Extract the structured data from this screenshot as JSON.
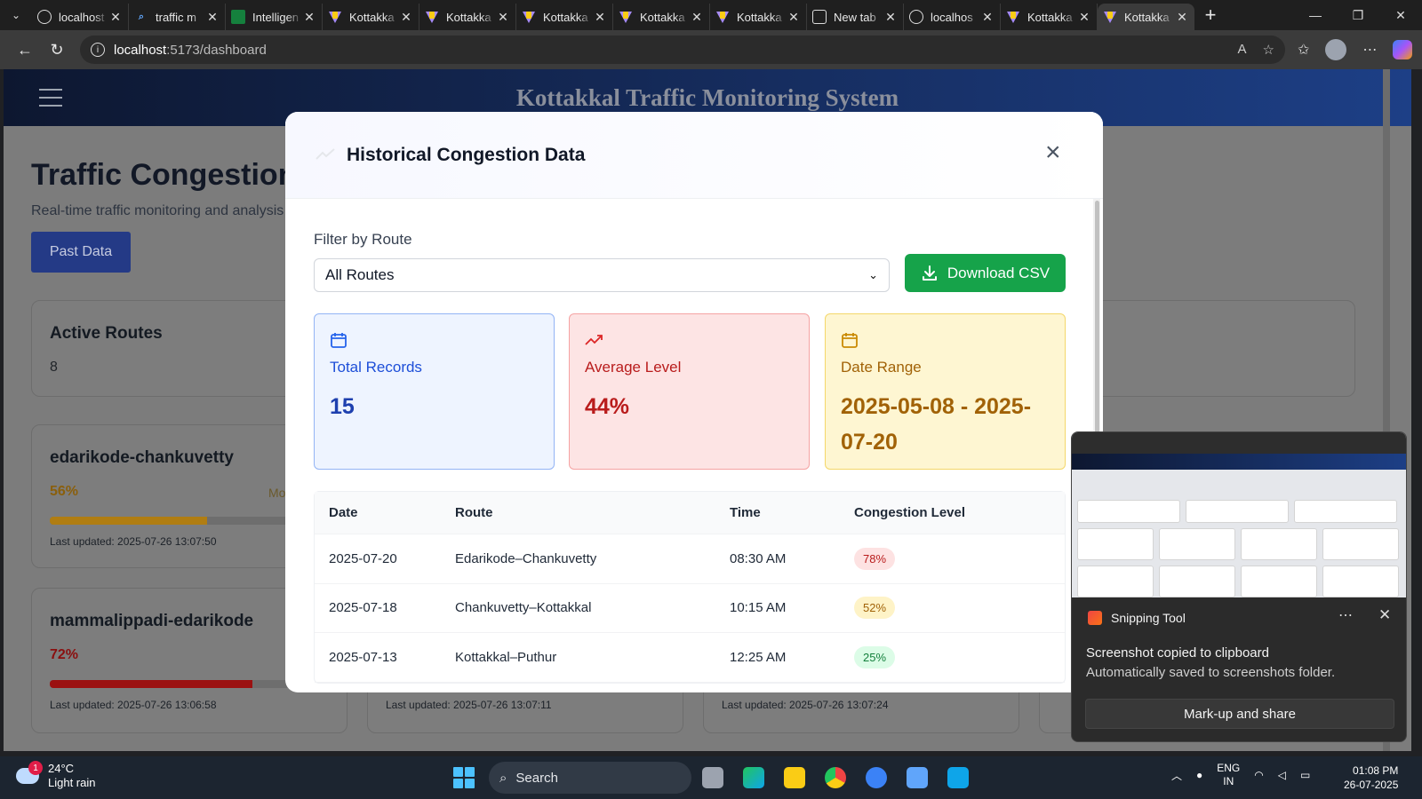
{
  "browser": {
    "tabs": [
      {
        "title": "localhost",
        "icon": "github-icon",
        "active": false
      },
      {
        "title": "traffic m",
        "icon": "search-icon",
        "active": false
      },
      {
        "title": "Intelligen",
        "icon": "int-icon",
        "active": false
      },
      {
        "title": "Kottakka",
        "icon": "vite-icon",
        "active": false
      },
      {
        "title": "Kottakka",
        "icon": "vite-icon",
        "active": false
      },
      {
        "title": "Kottakka",
        "icon": "vite-icon",
        "active": false
      },
      {
        "title": "Kottakka",
        "icon": "vite-icon",
        "active": false
      },
      {
        "title": "Kottakka",
        "icon": "vite-icon",
        "active": false
      },
      {
        "title": "New tab",
        "icon": "newtab-icon",
        "active": false
      },
      {
        "title": "localhos",
        "icon": "github-icon",
        "active": false
      },
      {
        "title": "Kottakka",
        "icon": "vite-icon",
        "active": false
      },
      {
        "title": "Kottakka",
        "icon": "vite-icon",
        "active": true
      }
    ],
    "url_host": "localhost",
    "url_path": ":5173/dashboard"
  },
  "app": {
    "title": "Kottakkal Traffic Monitoring System",
    "dashboard_title": "Traffic Congestion Dashboard",
    "dashboard_subtitle": "Real-time traffic monitoring and analysis",
    "past_data_button": "Past Data",
    "active_routes_label": "Active Routes",
    "active_routes_value": "8",
    "route_cards": [
      {
        "name": "edarikode-chankuvetty",
        "percent": "56%",
        "level": "Mo",
        "fraction": 0.56,
        "color": "#b07d12",
        "updated": "Last updated: 2025-07-26 13:07:50"
      },
      {
        "name": "mammalippadi-edarikode",
        "percent": "72%",
        "level": "",
        "fraction": 0.72,
        "color": "#9b1111",
        "updated": "Last updated: 2025-07-26 13:06:58"
      }
    ],
    "partial_updates": [
      "Last updated: 2025-07-26 13:07:11",
      "Last updated: 2025-07-26 13:07:24"
    ]
  },
  "modal": {
    "title": "Historical Congestion Data",
    "filter_label": "Filter by Route",
    "filter_value": "All Routes",
    "download_label": "Download CSV",
    "stats": {
      "total_label": "Total Records",
      "total_value": "15",
      "avg_label": "Average Level",
      "avg_value": "44%",
      "range_label": "Date Range",
      "range_value": "2025-05-08 - 2025-07-20"
    },
    "table": {
      "headers": [
        "Date",
        "Route",
        "Time",
        "Congestion Level"
      ],
      "rows": [
        {
          "date": "2025-07-20",
          "route": "Edarikode–Chankuvetty",
          "time": "08:30 AM",
          "level": "78%",
          "bg": "#fde2e2",
          "fg": "#b91c1c"
        },
        {
          "date": "2025-07-18",
          "route": "Chankuvetty–Kottakkal",
          "time": "10:15 AM",
          "level": "52%",
          "bg": "#fef3c7",
          "fg": "#a16207"
        },
        {
          "date": "2025-07-13",
          "route": "Kottakkal–Puthur",
          "time": "12:25 AM",
          "level": "25%",
          "bg": "#dcfce7",
          "fg": "#15803d"
        }
      ]
    }
  },
  "toast": {
    "app_name": "Snipping Tool",
    "message": "Screenshot copied to clipboard",
    "detail": "Automatically saved to screenshots folder.",
    "button": "Mark-up and share"
  },
  "taskbar": {
    "weather_temp": "24°C",
    "weather_desc": "Light rain",
    "weather_badge": "1",
    "search_label": "Search",
    "lang_top": "ENG",
    "lang_bottom": "IN",
    "time": "01:08 PM",
    "date": "26-07-2025"
  }
}
